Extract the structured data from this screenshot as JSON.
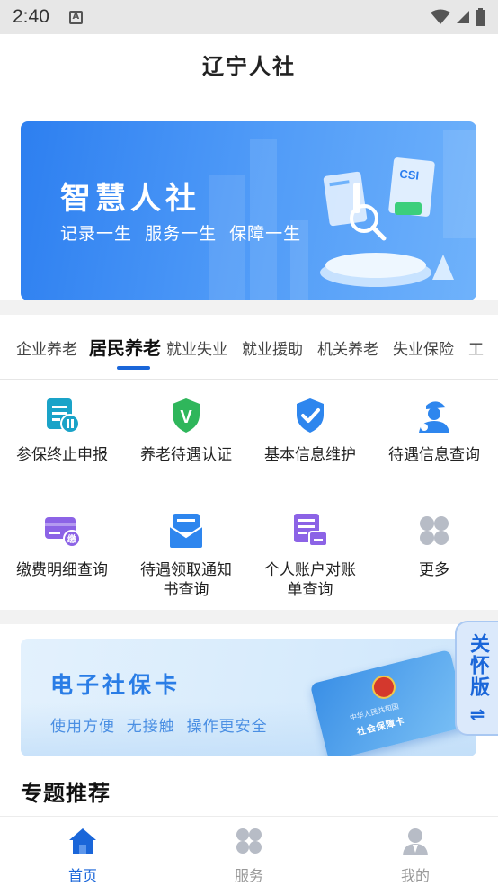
{
  "status_bar": {
    "time": "2:40"
  },
  "header": {
    "title": "辽宁人社"
  },
  "banner": {
    "title": "智慧人社",
    "subtitle": "记录一生  服务一生  保障一生"
  },
  "tabs": [
    {
      "label": "企业养老",
      "active": false
    },
    {
      "label": "居民养老",
      "active": true
    },
    {
      "label": "就业失业",
      "active": false
    },
    {
      "label": "就业援助",
      "active": false
    },
    {
      "label": "机关养老",
      "active": false
    },
    {
      "label": "失业保险",
      "active": false
    },
    {
      "label": "工",
      "active": false
    }
  ],
  "services": [
    {
      "label": "参保终止申报",
      "icon": "form-pause-icon"
    },
    {
      "label": "养老待遇认证",
      "icon": "shield-v-icon"
    },
    {
      "label": "基本信息维护",
      "icon": "shield-check-icon"
    },
    {
      "label": "待遇信息查询",
      "icon": "person-cap-icon"
    },
    {
      "label": "缴费明细查询",
      "icon": "card-payment-icon"
    },
    {
      "label": "待遇领取通知书查询",
      "icon": "envelope-icon"
    },
    {
      "label": "个人账户对账单查询",
      "icon": "statement-print-icon"
    },
    {
      "label": "更多",
      "icon": "more-grid-icon"
    }
  ],
  "ecard": {
    "title": "电子社保卡",
    "subtitle": "使用方便  无接触  操作更安全",
    "card_line1": "中华人民共和国",
    "card_line2": "社会保障卡"
  },
  "care_mode": {
    "label": "关怀版"
  },
  "topics": {
    "title": "专题推荐"
  },
  "bottom_nav": [
    {
      "label": "首页",
      "active": true
    },
    {
      "label": "服务",
      "active": false
    },
    {
      "label": "我的",
      "active": false
    }
  ],
  "colors": {
    "accent": "#1a66d9",
    "icon_blue": "#2e86ee",
    "icon_purple": "#8c63e6",
    "icon_green": "#2fb65b",
    "icon_teal": "#1aa3c8",
    "inactive": "#b7bcc6"
  }
}
